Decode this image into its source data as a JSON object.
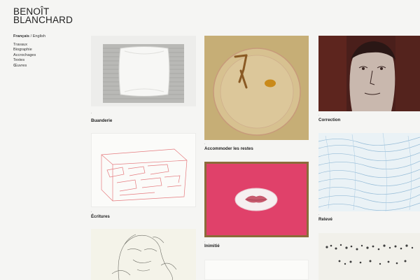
{
  "brand": {
    "line1": "BENOÎT",
    "line2": "BLANCHARD"
  },
  "languages": {
    "active": "Français",
    "separator": " / ",
    "other": "English"
  },
  "nav": [
    "Travaux",
    "Biographie",
    "Accrochages",
    "Textes",
    "Œuvres"
  ],
  "works": [
    {
      "title": "Buanderie",
      "marker": "."
    },
    {
      "title": "Accommoder les restes",
      "marker": "."
    },
    {
      "title": "Correction",
      "marker": "."
    },
    {
      "title": "Écritures",
      "marker": "."
    },
    {
      "title": "Inimitié",
      "marker": "."
    },
    {
      "title": "Relevé",
      "marker": "."
    }
  ],
  "colors": {
    "background": "#f5f5f3",
    "text": "#222222",
    "pink": "#e0446f"
  }
}
